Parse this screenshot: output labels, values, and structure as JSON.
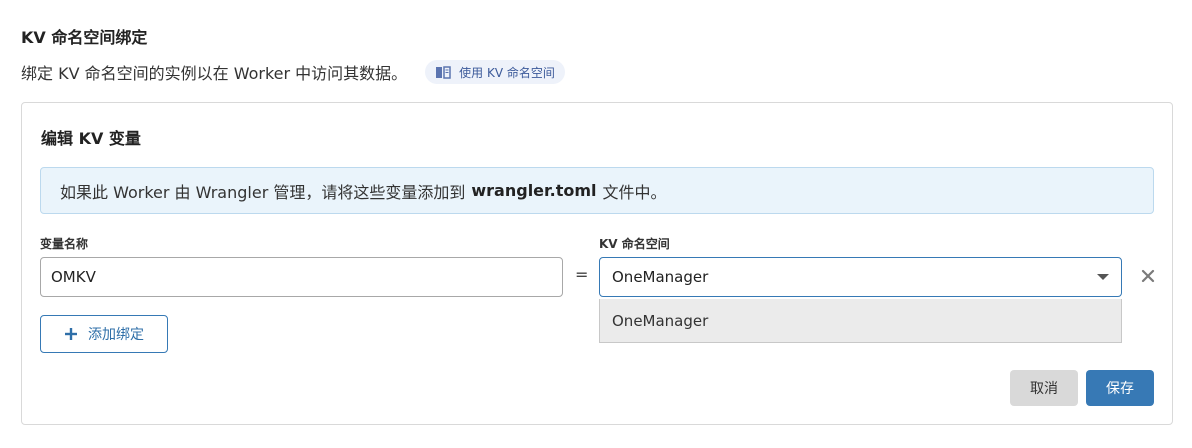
{
  "section": {
    "title": "KV 命名空间绑定",
    "description": "绑定 KV 命名空间的实例以在 Worker 中访问其数据。",
    "doc_link": {
      "label": "使用 KV 命名空间",
      "icon": "book-icon"
    }
  },
  "card": {
    "title": "编辑 KV 变量",
    "notice": {
      "prefix": "如果此 Worker 由 Wrangler 管理，请将这些变量添加到",
      "filename": "wrangler.toml",
      "suffix": "文件中。"
    },
    "binding": {
      "variable_label": "变量名称",
      "variable_value": "OMKV",
      "equals": "=",
      "namespace_label": "KV 命名空间",
      "namespace_selected": "OneManager",
      "namespace_options": [
        "OneManager"
      ],
      "remove_icon": "close-icon",
      "caret_icon": "chevron-down-icon"
    },
    "add_binding_label": "添加绑定",
    "cancel_label": "取消",
    "save_label": "保存"
  },
  "colors": {
    "accent": "#3779b5",
    "banner_bg": "#eaf4fb",
    "pill_bg": "#eef2fa",
    "dropdown_bg": "#ebebeb"
  }
}
